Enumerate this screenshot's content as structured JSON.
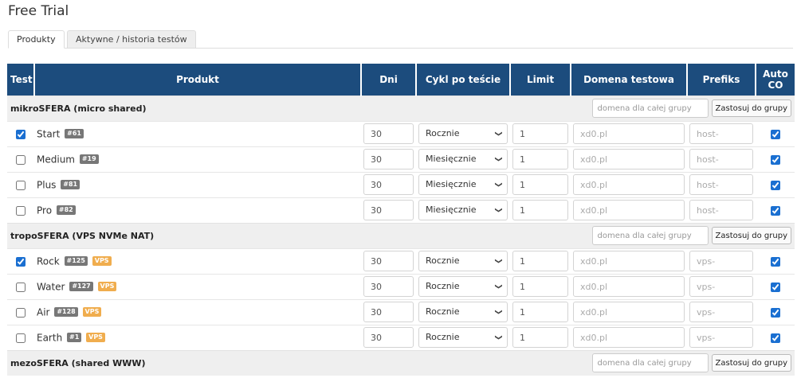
{
  "page": {
    "title": "Free Trial"
  },
  "tabs": [
    {
      "label": "Produkty",
      "active": true
    },
    {
      "label": "Aktywne / historia testów",
      "active": false
    }
  ],
  "table": {
    "headers": {
      "test": "Test",
      "produkt": "Produkt",
      "dni": "Dni",
      "cykl": "Cykl po teście",
      "limit": "Limit",
      "domena": "Domena testowa",
      "prefiks": "Prefiks",
      "auto": "Auto CO"
    },
    "group_domain_placeholder": "domena dla całej grupy",
    "apply_label": "Zastosuj do grupy",
    "groups": [
      {
        "name": "mikroSFERA (micro shared)",
        "rows": [
          {
            "checked": true,
            "name": "Start",
            "id": "#61",
            "days": "30",
            "cycle": "Rocznie",
            "limit": "1",
            "domain": "xd0.pl",
            "prefix": "host-",
            "auto": true
          },
          {
            "checked": false,
            "name": "Medium",
            "id": "#19",
            "days": "30",
            "cycle": "Miesięcznie",
            "limit": "1",
            "domain": "xd0.pl",
            "prefix": "host-",
            "auto": true
          },
          {
            "checked": false,
            "name": "Plus",
            "id": "#81",
            "days": "30",
            "cycle": "Miesięcznie",
            "limit": "1",
            "domain": "xd0.pl",
            "prefix": "host-",
            "auto": true
          },
          {
            "checked": false,
            "name": "Pro",
            "id": "#82",
            "days": "30",
            "cycle": "Miesięcznie",
            "limit": "1",
            "domain": "xd0.pl",
            "prefix": "host-",
            "auto": true
          }
        ]
      },
      {
        "name": "tropoSFERA (VPS NVMe NAT)",
        "rows": [
          {
            "checked": true,
            "name": "Rock",
            "id": "#125",
            "tag": "VPS",
            "days": "30",
            "cycle": "Rocznie",
            "limit": "1",
            "domain": "xd0.pl",
            "prefix": "vps-",
            "auto": true
          },
          {
            "checked": false,
            "name": "Water",
            "id": "#127",
            "tag": "VPS",
            "days": "30",
            "cycle": "Rocznie",
            "limit": "1",
            "domain": "xd0.pl",
            "prefix": "vps-",
            "auto": true
          },
          {
            "checked": false,
            "name": "Air",
            "id": "#128",
            "tag": "VPS",
            "days": "30",
            "cycle": "Rocznie",
            "limit": "1",
            "domain": "xd0.pl",
            "prefix": "vps-",
            "auto": true
          },
          {
            "checked": false,
            "name": "Earth",
            "id": "#1",
            "tag": "VPS",
            "days": "30",
            "cycle": "Rocznie",
            "limit": "1",
            "domain": "xd0.pl",
            "prefix": "vps-",
            "auto": true
          }
        ]
      },
      {
        "name": "mezoSFERA (shared WWW)",
        "rows": []
      }
    ]
  }
}
